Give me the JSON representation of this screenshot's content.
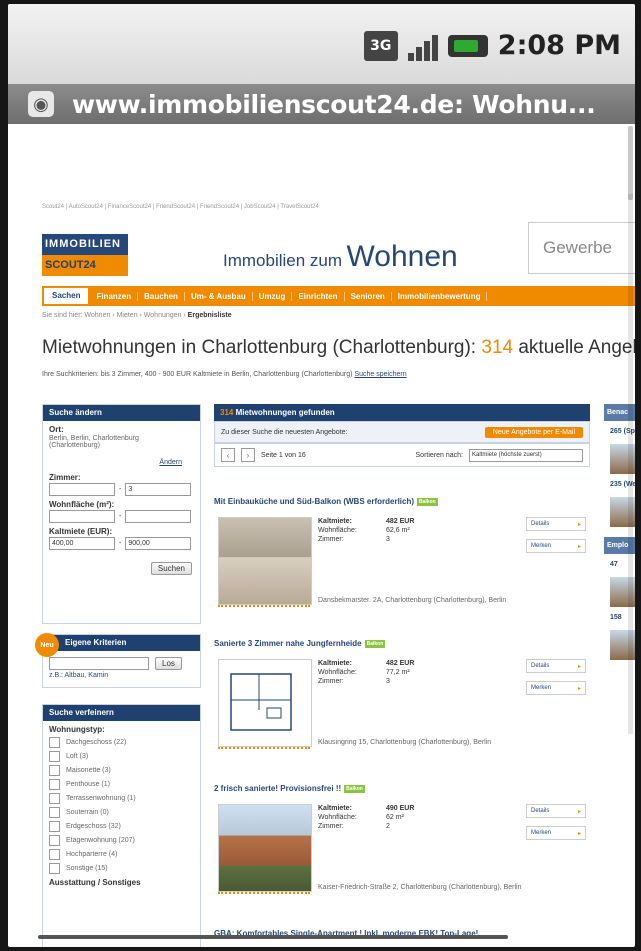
{
  "status": {
    "network": "3G",
    "time": "2:08 PM"
  },
  "browser": {
    "url": "www.immobilienscout24.de: Wohnu..."
  },
  "site": {
    "topnav": "Scout24  |  AutoScout24  |  FinanceScout24  |  FriendScout24  |  FriendScout24  |  JobScout24  |  TravelScout24",
    "logo_line1": "IMMOBILIEN",
    "logo_line2": "SCOUT24",
    "header_small": "Immobilien zum",
    "header_big": "Wohnen",
    "gewerbe": "Gewerbe",
    "tabs": [
      "Sachen",
      "Finanzen",
      "Bauchen",
      "Um- & Ausbau",
      "Umzug",
      "Einrichten",
      "Senioren",
      "Immobilienbewertung"
    ],
    "crumb_prefix": "Sie sind hier: Wohnen › Mieten › Wohnungen ›",
    "crumb_current": "Ergebnisliste",
    "heading_text": "Mietwohnungen in Charlottenburg (Charlottenburg):",
    "heading_count": "314",
    "heading_suffix": "aktuelle Angebote",
    "criteria": "Ihre Suchkriterien: bis 3 Zimmer, 400 - 900 EUR Kaltmiete in Berlin, Charlottenburg (Charlottenburg)",
    "criteria_link": "Suche speichern"
  },
  "search_box": {
    "title": "Suche ändern",
    "ort_label": "Ort:",
    "ort_value": "Berlin, Berlin, Charlottenburg (Charlottenburg)",
    "change_link": "Ändern",
    "zimmer_label": "Zimmer:",
    "zimmer_to": "3",
    "flaeche_label": "Wohnfläche (m²):",
    "miete_label": "Kaltmiete (EUR):",
    "miete_from": "400,00",
    "miete_to": "900,00",
    "search_btn": "Suchen"
  },
  "criteria_box": {
    "badge": "Neu",
    "title": "Eigene Kriterien",
    "go_btn": "Los",
    "hint": "z.B.: Altbau, Kamin"
  },
  "refine_box": {
    "title": "Suche verfeinern",
    "type_label": "Wohnungstyp:",
    "types": [
      "Dachgeschoss (22)",
      "Loft (3)",
      "Maisonette (3)",
      "Penthouse (1)",
      "Terrassenwohnung (1)",
      "Souterrain (0)",
      "Erdgeschoss (32)",
      "Etagenwohnung (207)",
      "Hochparterre (4)",
      "Sonstige (15)"
    ],
    "footer": "Ausstattung / Sonstiges"
  },
  "results": {
    "count": "314",
    "head": "Mietwohnungen gefunden",
    "sub": "Zu dieser Suche die neuesten Angebote:",
    "email_btn": "Neue Angebote per E-Mail",
    "page_text": "Seite 1 von 16",
    "sort_label": "Sortieren nach:",
    "sort_value": "Kaltmiete (höchste zuerst)"
  },
  "listings": [
    {
      "title": "Mit Einbauküche und Süd-Balkon (WBS erforderlich)",
      "tag": "Balkon",
      "k1": "Kaltmiete:",
      "v1": "482 EUR",
      "k2": "Wohnfläche:",
      "v2": "62,6 m²",
      "k3": "Zimmer:",
      "v3": "3",
      "address": "Dansbekmarster. 2A, Charlottenburg (Charlottenburg), Berlin",
      "btn1": "Details",
      "btn2": "Merken"
    },
    {
      "title": "Sanierte 3 Zimmer nahe Jungfernheide",
      "tag": "Balkon",
      "k1": "Kaltmiete:",
      "v1": "482 EUR",
      "k2": "Wohnfläche:",
      "v2": "77,2 m²",
      "k3": "Zimmer:",
      "v3": "3",
      "address": "Klausingring 15, Charlottenburg (Charlottenburg), Berlin",
      "btn1": "Details",
      "btn2": "Merken"
    },
    {
      "title": "2 frisch sanierte! Provisionsfrei !!",
      "tag": "Balkon",
      "k1": "Kaltmiete:",
      "v1": "490 EUR",
      "k2": "Wohnfläche:",
      "v2": "62 m²",
      "k3": "Zimmer:",
      "v3": "2",
      "address": "Kaiser-Friedrich-Straße 2, Charlottenburg (Charlottenburg), Berlin",
      "btn1": "Details",
      "btn2": "Merken"
    },
    {
      "title": "GBA: Komfortables Single-Apartment ! Inkl. moderne EBK! Top-Lage!"
    }
  ],
  "rightcol": {
    "head": "Benac",
    "link1": "265 (Sp",
    "link2": "235 (We",
    "head2": "Emplo",
    "link3": "47",
    "link4": "158"
  }
}
